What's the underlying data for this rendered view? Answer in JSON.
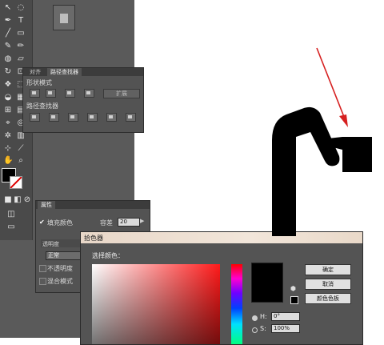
{
  "pathfinder_panel": {
    "tabs": [
      "对齐",
      "路径查找器"
    ],
    "shape_modes_label": "形状模式",
    "expand_button": "扩展",
    "pathfinders_label": "路径查找器"
  },
  "appearance_panel": {
    "tab": "属性",
    "fill_color_label": "填充颜色",
    "overprint_label": "容差",
    "tolerance_value": "20",
    "transparency_label": "透明度",
    "blend_mode_value": "正常",
    "opacity_label": "不透明度",
    "blend_label": "混合模式"
  },
  "color_picker": {
    "title": "拾色器",
    "select_color_label": "选择颜色：",
    "ok_button": "确定",
    "cancel_button": "取消",
    "swatches_button": "颜色色板",
    "h_label": "H:",
    "h_value": "0°",
    "s_label": "S:",
    "s_value": "100%",
    "current_color": "#000000",
    "hue_color": "#ff1a1a"
  },
  "canvas": {
    "figure_color": "#000000",
    "arrow_color": "#d62020"
  }
}
